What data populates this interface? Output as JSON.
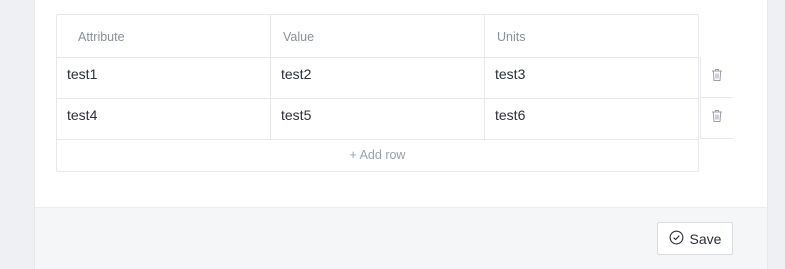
{
  "table": {
    "columns": [
      "Attribute",
      "Value",
      "Units"
    ],
    "rows": [
      [
        "test1",
        "test2",
        "test3"
      ],
      [
        "test4",
        "test5",
        "test6"
      ]
    ],
    "add_row_label": "+ Add row"
  },
  "footer": {
    "save_label": "Save"
  },
  "icons": {
    "delete": "trash-icon",
    "save": "check-circle-icon"
  }
}
